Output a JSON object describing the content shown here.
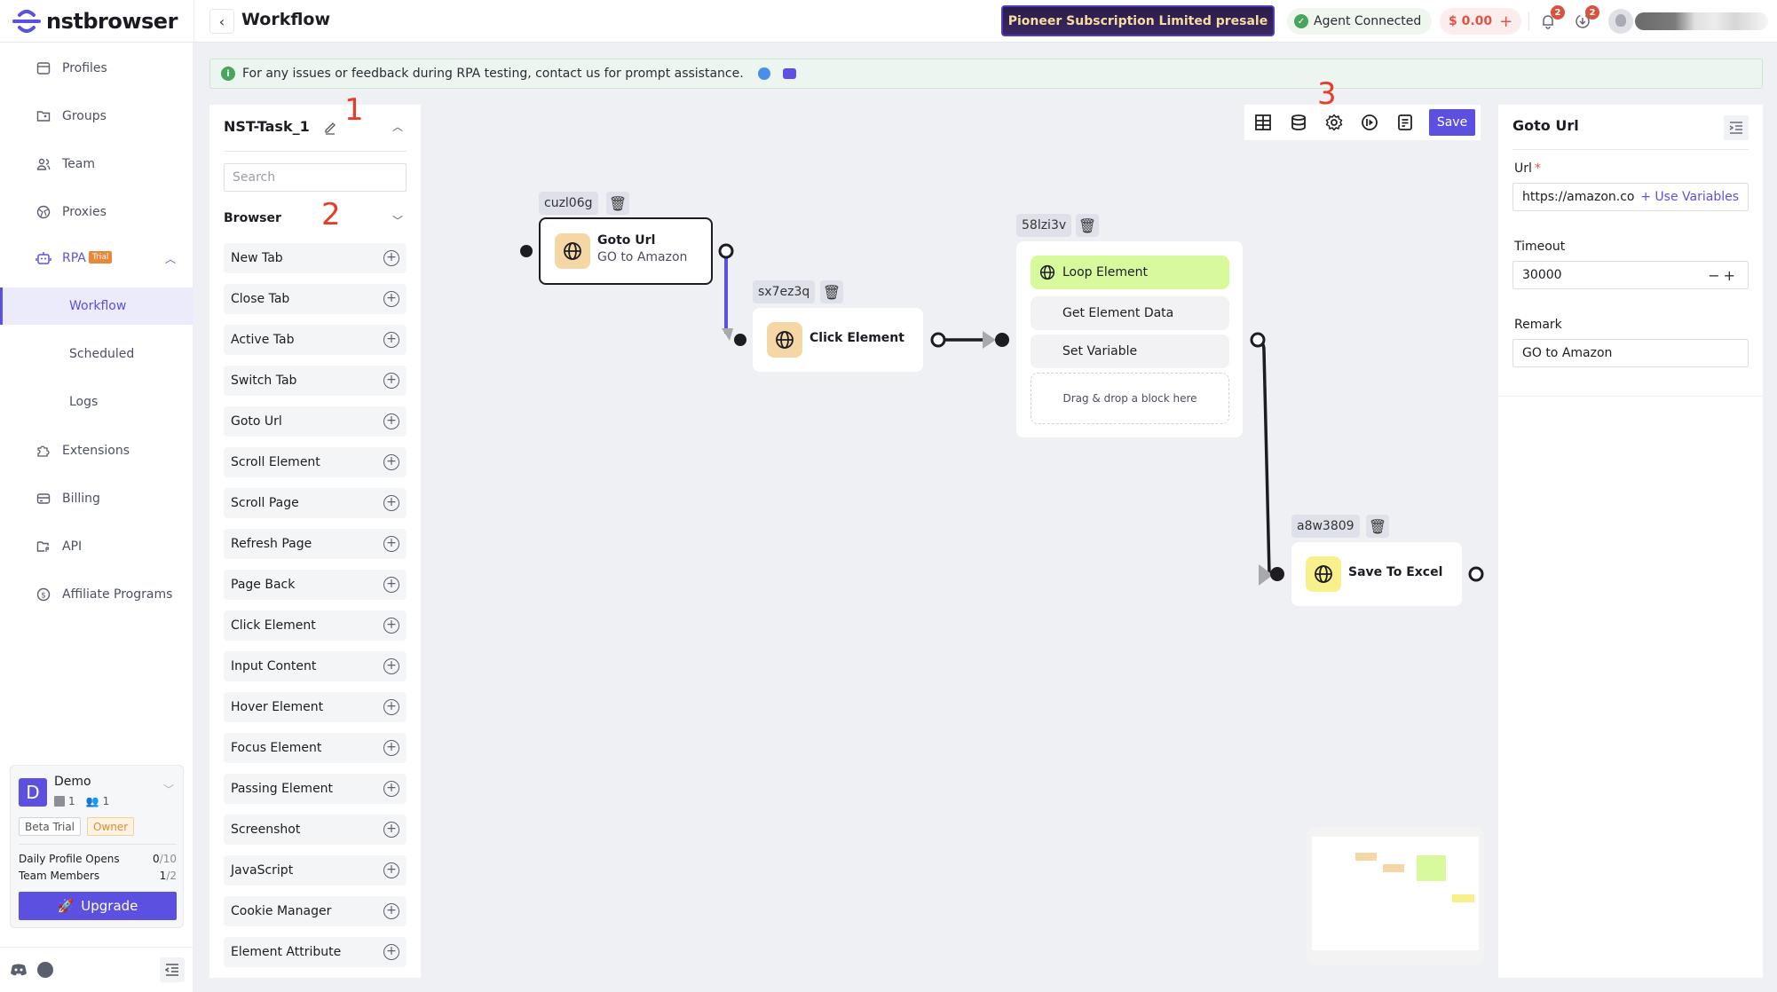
{
  "app": {
    "brand": "nstbrowser",
    "page_title": "Workflow"
  },
  "header": {
    "promo_label": "Pioneer Subscription Limited presale",
    "agent_status": "Agent Connected",
    "balance": "$ 0.00",
    "balance_add": "+",
    "notifications_count": "2",
    "downloads_count": "2"
  },
  "sidebar": {
    "items": [
      {
        "label": "Profiles",
        "icon": "profiles-icon"
      },
      {
        "label": "Groups",
        "icon": "groups-icon"
      },
      {
        "label": "Team",
        "icon": "team-icon"
      },
      {
        "label": "Proxies",
        "icon": "proxies-icon"
      },
      {
        "label": "RPA",
        "icon": "robot-icon",
        "badge": "Trial",
        "expanded": true
      },
      {
        "label": "Workflow",
        "sub": true,
        "active": true
      },
      {
        "label": "Scheduled",
        "sub": true
      },
      {
        "label": "Logs",
        "sub": true
      },
      {
        "label": "Extensions",
        "icon": "extensions-icon"
      },
      {
        "label": "Billing",
        "icon": "billing-icon"
      },
      {
        "label": "API",
        "icon": "api-icon"
      },
      {
        "label": "Affiliate Programs",
        "icon": "affiliate-icon"
      }
    ],
    "account": {
      "initial": "D",
      "name": "Demo",
      "profiles_count": "1",
      "members_count": "1",
      "plan_tag": "Beta Trial",
      "role_tag": "Owner",
      "daily_opens_label": "Daily Profile Opens",
      "daily_opens_used": "0",
      "daily_opens_limit": "/10",
      "team_members_label": "Team Members",
      "team_members_used": "1",
      "team_members_limit": "/2",
      "upgrade_label": "Upgrade"
    }
  },
  "banner": {
    "text": "For any issues or feedback during RPA testing, contact us for prompt assistance."
  },
  "left_panel": {
    "task_name": "NST-Task_1",
    "search_placeholder": "Search",
    "category": "Browser",
    "blocks": [
      "New Tab",
      "Close Tab",
      "Active Tab",
      "Switch Tab",
      "Goto Url",
      "Scroll Element",
      "Scroll Page",
      "Refresh Page",
      "Page Back",
      "Click Element",
      "Input Content",
      "Hover Element",
      "Focus Element",
      "Passing Element",
      "Screenshot",
      "JavaScript",
      "Cookie Manager",
      "Element Attribute"
    ]
  },
  "annotations": [
    "1",
    "2",
    "3"
  ],
  "toolbar": {
    "icons": [
      "table-icon",
      "database-icon",
      "settings-icon",
      "run-icon",
      "log-icon"
    ],
    "save_label": "Save"
  },
  "canvas": {
    "nodes": [
      {
        "id": "cuzl06g",
        "title": "Goto Url",
        "subtitle": "GO to Amazon",
        "icon_color": "#f5d7a5",
        "selected": true
      },
      {
        "id": "sx7ez3q",
        "title": "Click Element",
        "subtitle": "",
        "icon_color": "#f5d7a5"
      },
      {
        "id": "58lzi3v",
        "title": "Loop Element",
        "children": [
          "Get Element Data",
          "Set Variable"
        ],
        "drop_hint": "Drag & drop a block here",
        "head_color": "#d9f99d"
      },
      {
        "id": "a8w3809",
        "title": "Save To Excel",
        "subtitle": "",
        "icon_color": "#f8f08a"
      }
    ]
  },
  "right_panel": {
    "title": "Goto Url",
    "url_label": "Url",
    "url_required": "*",
    "url_value": "https://amazon.co",
    "use_variables": "+ Use Variables",
    "timeout_label": "Timeout",
    "timeout_value": "30000",
    "remark_label": "Remark",
    "remark_value": "GO to Amazon"
  },
  "colors": {
    "accent": "#5b50e0",
    "trial_badge": "#e8893a",
    "danger": "#e05446",
    "success": "#4aa35e"
  }
}
